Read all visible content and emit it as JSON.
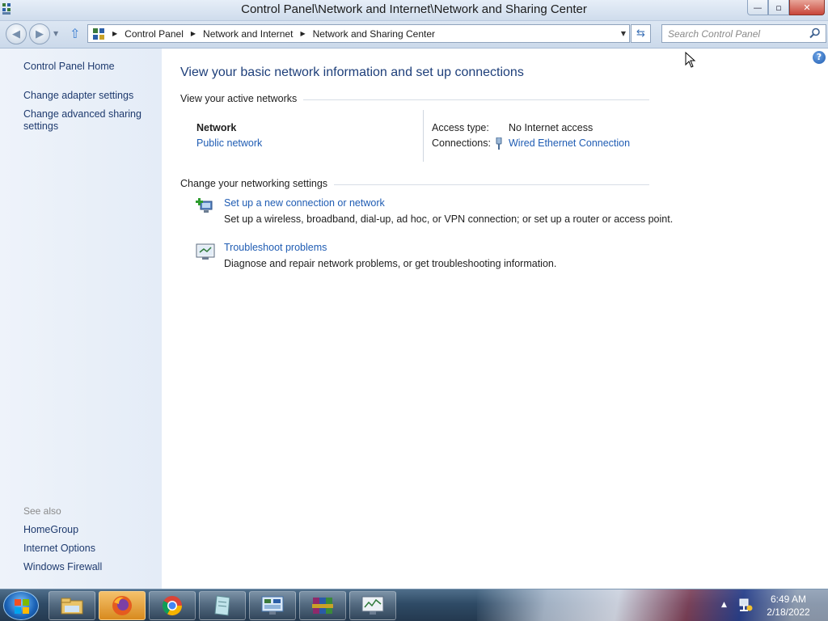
{
  "window": {
    "title": "Control Panel\\Network and Internet\\Network and Sharing Center",
    "buttons": {
      "minimize": "—",
      "maximize": "▫",
      "close": "✕"
    }
  },
  "address_bar": {
    "breadcrumbs": [
      "Control Panel",
      "Network and Internet",
      "Network and Sharing Center"
    ],
    "search_placeholder": "Search Control Panel"
  },
  "sidebar": {
    "items": [
      {
        "label": "Control Panel Home"
      },
      {
        "label": "Change adapter settings"
      },
      {
        "label": "Change advanced sharing settings"
      }
    ],
    "see_also_label": "See also",
    "see_also": [
      {
        "label": "HomeGroup"
      },
      {
        "label": "Internet Options"
      },
      {
        "label": "Windows Firewall"
      }
    ]
  },
  "main": {
    "heading": "View your basic network information and set up connections",
    "active_networks_label": "View your active networks",
    "network": {
      "name": "Network",
      "type": "Public network",
      "access_type_label": "Access type:",
      "access_type_value": "No Internet access",
      "connections_label": "Connections:",
      "connections_value": "Wired Ethernet Connection"
    },
    "change_settings_label": "Change your networking settings",
    "tasks": [
      {
        "link": "Set up a new connection or network",
        "description": "Set up a wireless, broadband, dial-up, ad hoc, or VPN connection; or set up a router or access point.",
        "icon": "new-connection-icon"
      },
      {
        "link": "Troubleshoot problems",
        "description": "Diagnose and repair network problems, or get troubleshooting information.",
        "icon": "troubleshoot-icon"
      }
    ]
  },
  "taskbar": {
    "apps": [
      "file-explorer-icon",
      "firefox-icon",
      "chrome-icon",
      "notepad-icon",
      "control-panel-icon",
      "winrar-icon",
      "task-manager-icon"
    ],
    "clock_time": "6:49 AM",
    "clock_date": "2/18/2022"
  }
}
